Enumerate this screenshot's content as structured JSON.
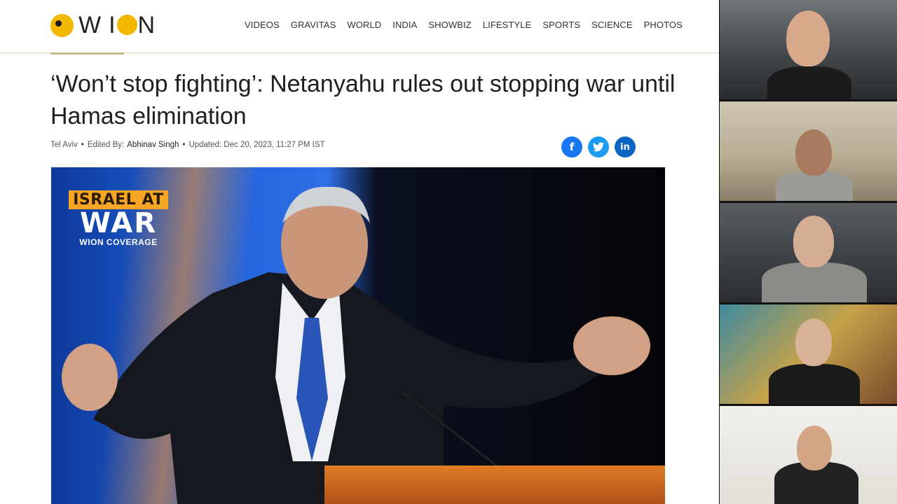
{
  "site": {
    "logo_text": "WION",
    "nav": [
      "VIDEOS",
      "GRAVITAS",
      "WORLD",
      "INDIA",
      "SHOWBIZ",
      "LIFESTYLE",
      "SPORTS",
      "SCIENCE",
      "PHOTOS"
    ]
  },
  "article": {
    "headline": "‘Won’t stop fighting’: Netanyahu rules out stopping war until Hamas elimination",
    "location": "Tel Aviv",
    "edited_by_label": "Edited By:",
    "editor": "Abhinav Singh",
    "updated": "Updated: Dec 20, 2023, 11:27 PM IST",
    "share": [
      {
        "name": "facebook",
        "glyph": "f"
      },
      {
        "name": "twitter",
        "glyph": "t"
      },
      {
        "name": "linkedin",
        "glyph": "in"
      }
    ]
  },
  "hero": {
    "badge_line1": "ISRAEL AT",
    "badge_line2": "WAR",
    "badge_line3": "WION COVERAGE"
  },
  "video_tiles": [
    {
      "id": "participant-1"
    },
    {
      "id": "participant-2"
    },
    {
      "id": "participant-3"
    },
    {
      "id": "participant-4"
    },
    {
      "id": "participant-5"
    }
  ],
  "colors": {
    "brand_yellow": "#f4b700",
    "facebook": "#1877f2",
    "twitter": "#1d9bf0",
    "linkedin": "#0a66c2",
    "badge_orange": "#f6a623"
  }
}
